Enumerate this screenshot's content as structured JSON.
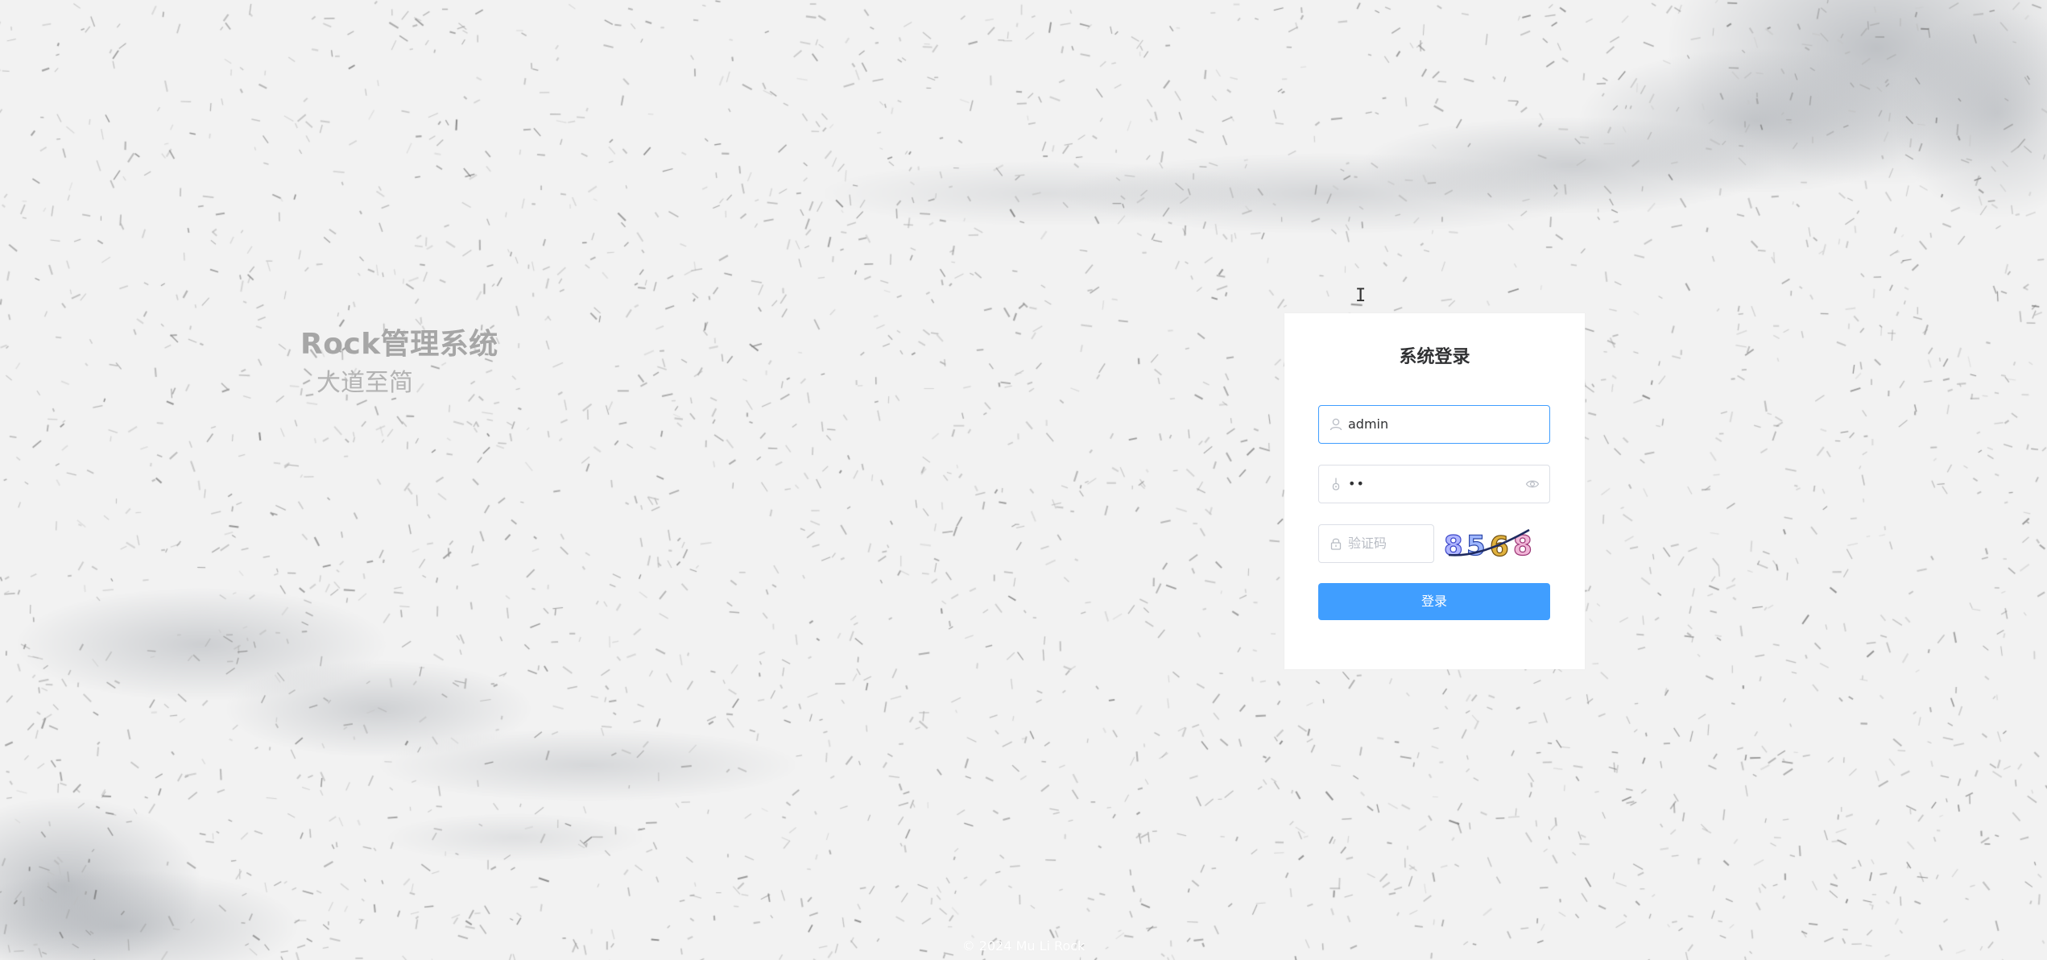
{
  "brand": {
    "title": "Rock管理系统",
    "subtitle": "大道至简"
  },
  "login": {
    "title": "系统登录",
    "username": {
      "value": "admin",
      "icon": "user-icon"
    },
    "password": {
      "value": "••",
      "icon": "password-icon",
      "toggle_icon": "eye-icon"
    },
    "captcha": {
      "placeholder": "验证码",
      "icon": "lock-icon",
      "image_digits": "8568"
    },
    "submit_label": "登录"
  },
  "footer": {
    "text": "© 2024 Mu Li Rock"
  },
  "colors": {
    "primary": "#409eff",
    "brand_text": "#a6a6a6",
    "background": "#f2f2f2",
    "card": "#ffffff"
  }
}
